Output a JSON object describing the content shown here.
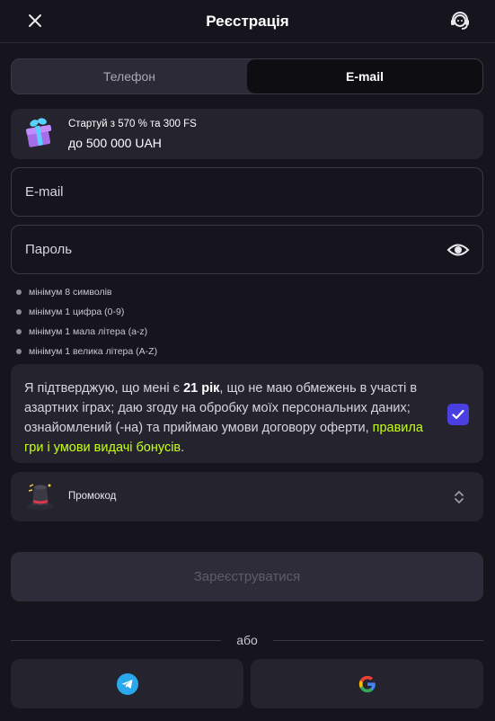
{
  "header": {
    "title": "Реєстрація",
    "close_icon": "close-icon",
    "support_icon": "support-agent-icon"
  },
  "tabs": [
    {
      "label": "Телефон",
      "active": false
    },
    {
      "label": "E-mail",
      "active": true
    }
  ],
  "bonus": {
    "icon": "gift-icon",
    "line1": "Стартуй з 570 % та 300 FS",
    "line2": "до 500 000 UAH"
  },
  "form": {
    "email_placeholder": "E-mail",
    "email_value": "",
    "password_placeholder": "Пароль",
    "password_value": "",
    "password_toggle_icon": "eye-icon"
  },
  "password_rules": [
    "мінімум 8 символів",
    "мінімум 1 цифра (0-9)",
    "мінімум 1 мала літера (a-z)",
    "мінімум 1 велика літера (A-Z)"
  ],
  "consent": {
    "text_before": "Я підтверджую, що мені є ",
    "age": "21 рік",
    "text_after": ", що не маю обмежень в участі в азартних іграх; даю згоду на обробку моїх персональних даних; ознайомлений (-на) та приймаю умови договору оферти, ",
    "link": "правила гри і умови видачі бонусів",
    "end": ".",
    "checked": true
  },
  "promo": {
    "icon": "magic-hat-icon",
    "label": "Промокод"
  },
  "submit_label": "Зареєструватися",
  "divider_label": "або",
  "social": [
    {
      "name": "telegram",
      "icon": "telegram-icon"
    },
    {
      "name": "google",
      "icon": "google-icon"
    }
  ],
  "colors": {
    "background": "#16151d",
    "card": "#24232e",
    "accent": "#4a3fe0",
    "link": "#c6ff1a"
  }
}
